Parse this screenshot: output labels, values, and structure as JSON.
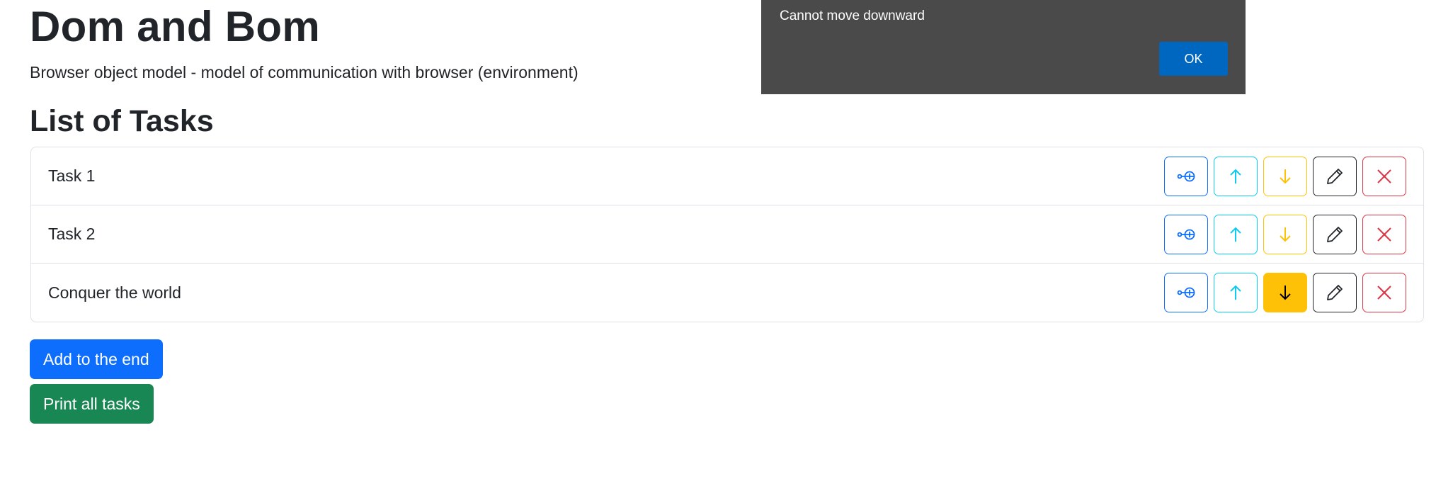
{
  "header": {
    "title": "Dom and Bom",
    "subtitle": "Browser object model - model of communication with browser (environment)"
  },
  "tasks_section": {
    "title": "List of Tasks",
    "items": [
      {
        "label": "Task 1",
        "down_active": false
      },
      {
        "label": "Task 2",
        "down_active": false
      },
      {
        "label": "Conquer the world",
        "down_active": true
      }
    ],
    "row_actions": [
      "insert-after-icon",
      "arrow-up-icon",
      "arrow-down-icon",
      "pencil-icon",
      "x-icon"
    ]
  },
  "buttons": {
    "add_label": "Add to the end",
    "print_label": "Print all tasks"
  },
  "alert": {
    "message": "Cannot move downward",
    "ok_label": "OK"
  },
  "colors": {
    "primary": "#0d6efd",
    "info": "#0dcaf0",
    "warning": "#ffc107",
    "dark": "#212529",
    "danger": "#dc3545",
    "success": "#198754",
    "dialog_bg": "#4a4a4a",
    "dialog_button": "#0067c0"
  }
}
